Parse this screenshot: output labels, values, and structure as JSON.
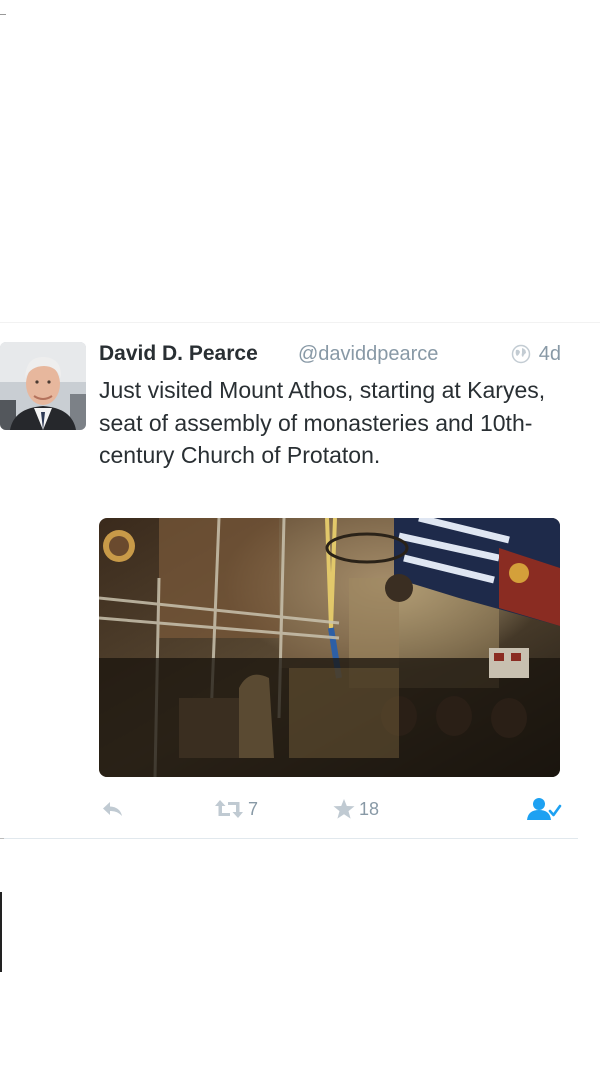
{
  "tweet": {
    "author_name": "David D. Pearce",
    "author_handle": "@daviddpearce",
    "time": "4d",
    "text": "Just visited Mount Athos, starting at Karyes, seat of assembly of monasteries and 10th-century Church of Protaton.",
    "actions": {
      "reply_icon": "reply-icon",
      "retweet_icon": "retweet-icon",
      "retweet_count": "7",
      "favorite_icon": "star-icon",
      "favorite_count": "18",
      "follow_icon": "follow-user-icon"
    },
    "colors": {
      "muted": "#8899a6",
      "text": "#292f33",
      "accent": "#1da1f2"
    }
  }
}
